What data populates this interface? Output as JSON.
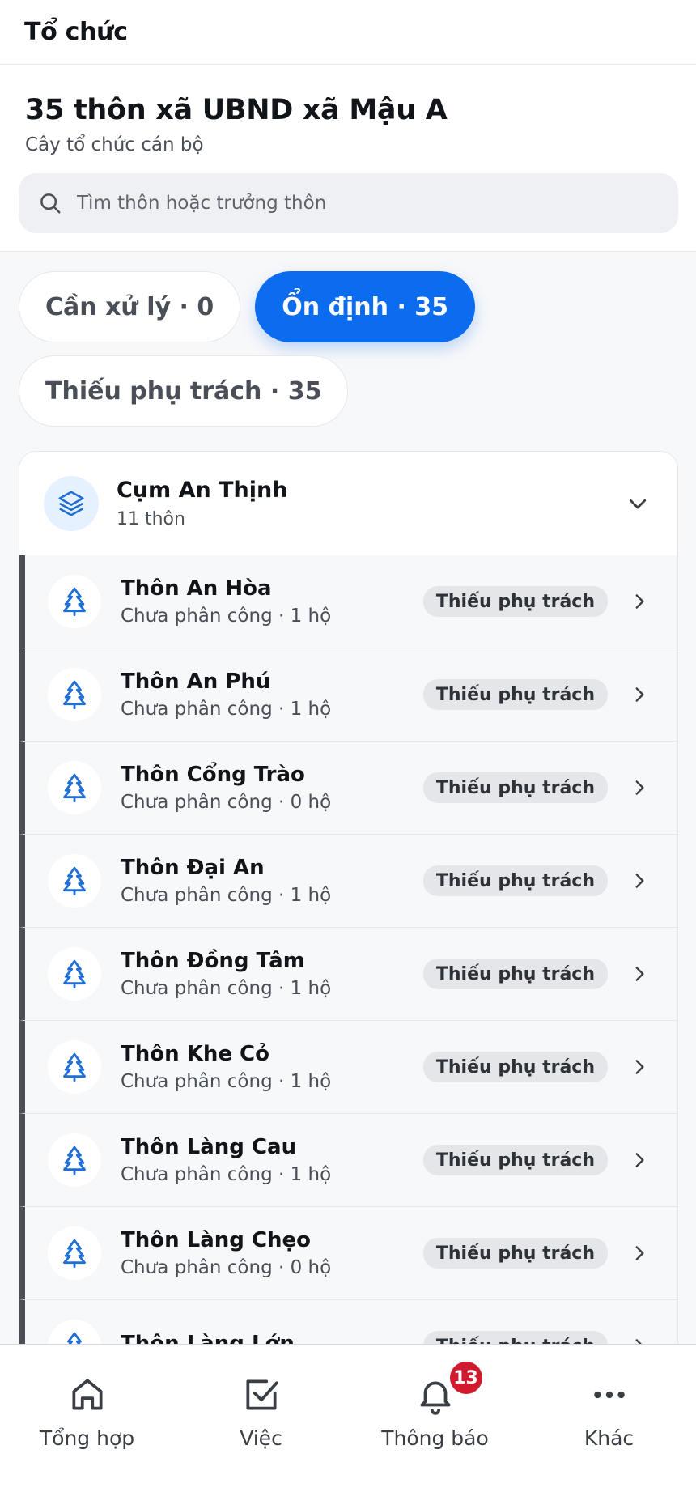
{
  "topbar": {
    "title": "Tổ chức"
  },
  "header": {
    "title": "35 thôn xã UBND xã Mậu A",
    "subtitle": "Cây tổ chức cán bộ",
    "search_placeholder": "Tìm thôn hoặc trưởng thôn"
  },
  "filters": [
    {
      "label": "Cần xử lý · 0",
      "active": false
    },
    {
      "label": "Ổn định · 35",
      "active": true
    },
    {
      "label": "Thiếu phụ trách · 35",
      "active": false
    }
  ],
  "cluster": {
    "name": "Cụm An Thịnh",
    "count": "11 thôn",
    "icon": "layers-icon",
    "villages": [
      {
        "name": "Thôn An Hòa",
        "sub": "Chưa phân công · 1 hộ",
        "badge": "Thiếu phụ trách"
      },
      {
        "name": "Thôn An Phú",
        "sub": "Chưa phân công · 1 hộ",
        "badge": "Thiếu phụ trách"
      },
      {
        "name": "Thôn Cổng Trào",
        "sub": "Chưa phân công · 0 hộ",
        "badge": "Thiếu phụ trách"
      },
      {
        "name": "Thôn Đại An",
        "sub": "Chưa phân công · 1 hộ",
        "badge": "Thiếu phụ trách"
      },
      {
        "name": "Thôn Đồng Tâm",
        "sub": "Chưa phân công · 1 hộ",
        "badge": "Thiếu phụ trách"
      },
      {
        "name": "Thôn Khe Cỏ",
        "sub": "Chưa phân công · 1 hộ",
        "badge": "Thiếu phụ trách"
      },
      {
        "name": "Thôn Làng Cau",
        "sub": "Chưa phân công · 1 hộ",
        "badge": "Thiếu phụ trách"
      },
      {
        "name": "Thôn Làng Chẹo",
        "sub": "Chưa phân công · 0 hộ",
        "badge": "Thiếu phụ trách"
      },
      {
        "name": "Thôn Làng Lớn",
        "sub": "",
        "badge": "Thiếu phụ trách"
      }
    ]
  },
  "bottom_nav": [
    {
      "label": "Tổng hợp",
      "icon": "home-icon"
    },
    {
      "label": "Việc",
      "icon": "checkbox-icon"
    },
    {
      "label": "Thông báo",
      "icon": "bell-icon",
      "badge": "13"
    },
    {
      "label": "Khác",
      "icon": "more-icon"
    }
  ],
  "colors": {
    "primary": "#0b6cf0",
    "badge_red": "#d21a2f",
    "tree_blue": "#1f6fd6"
  }
}
